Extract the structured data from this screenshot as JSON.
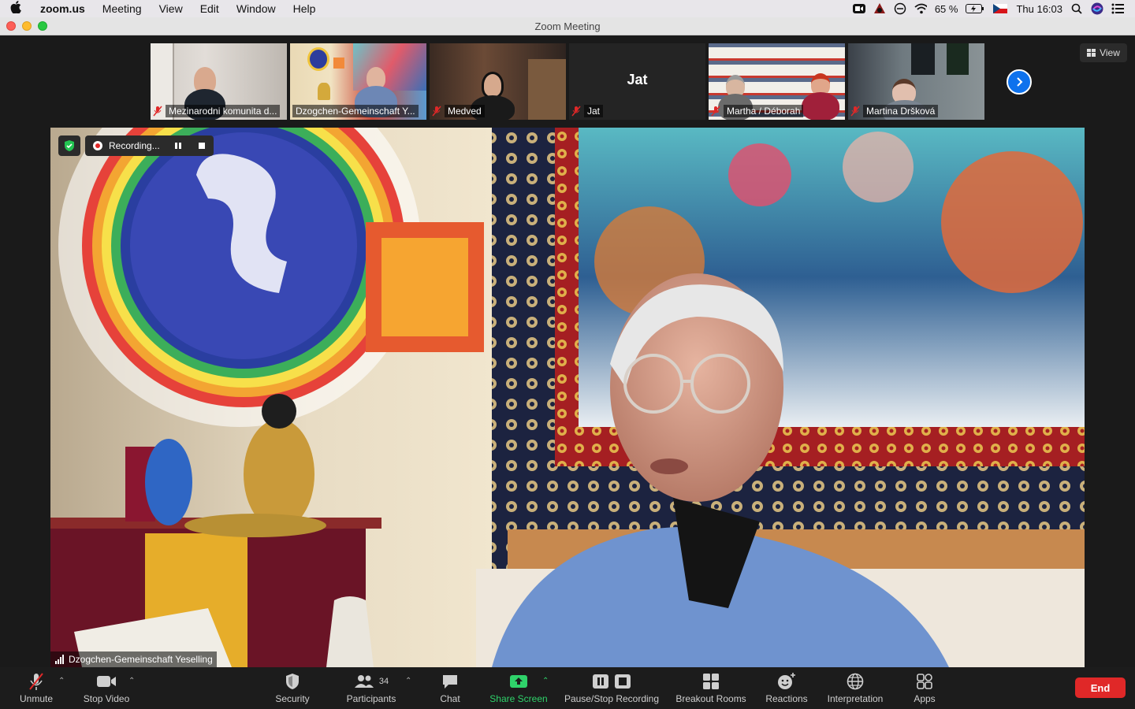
{
  "menubar": {
    "app": "zoom.us",
    "items": [
      "Meeting",
      "View",
      "Edit",
      "Window",
      "Help"
    ],
    "battery": "65 %",
    "clock": "Thu 16:03"
  },
  "window": {
    "title": "Zoom Meeting"
  },
  "participants_strip": [
    {
      "name": "Mezinarodni komunita d...",
      "muted": true
    },
    {
      "name": "Dzogchen-Gemeinschaft Y...",
      "muted": false,
      "active": true
    },
    {
      "name": "Medved",
      "muted": true
    },
    {
      "name": "Jat",
      "muted": true,
      "initial": "Jat"
    },
    {
      "name": "Martha / Déborah",
      "muted": true
    },
    {
      "name": "Martina Dršková",
      "muted": true
    }
  ],
  "view_button": "View",
  "recording": {
    "label": "Recording..."
  },
  "speaker": {
    "name": "Dzogchen-Gemeinschaft Yeselling"
  },
  "toolbar": {
    "unmute": "Unmute",
    "stop_video": "Stop Video",
    "security": "Security",
    "participants": "Participants",
    "participants_count": "34",
    "chat": "Chat",
    "share_screen": "Share Screen",
    "pause_stop_recording": "Pause/Stop Recording",
    "breakout_rooms": "Breakout Rooms",
    "reactions": "Reactions",
    "interpretation": "Interpretation",
    "apps": "Apps",
    "end": "End"
  },
  "colors": {
    "share_green": "#2fd26a",
    "end_red": "#e02828",
    "active_tile": "#f3f08c",
    "accent_blue": "#0e72ed"
  }
}
